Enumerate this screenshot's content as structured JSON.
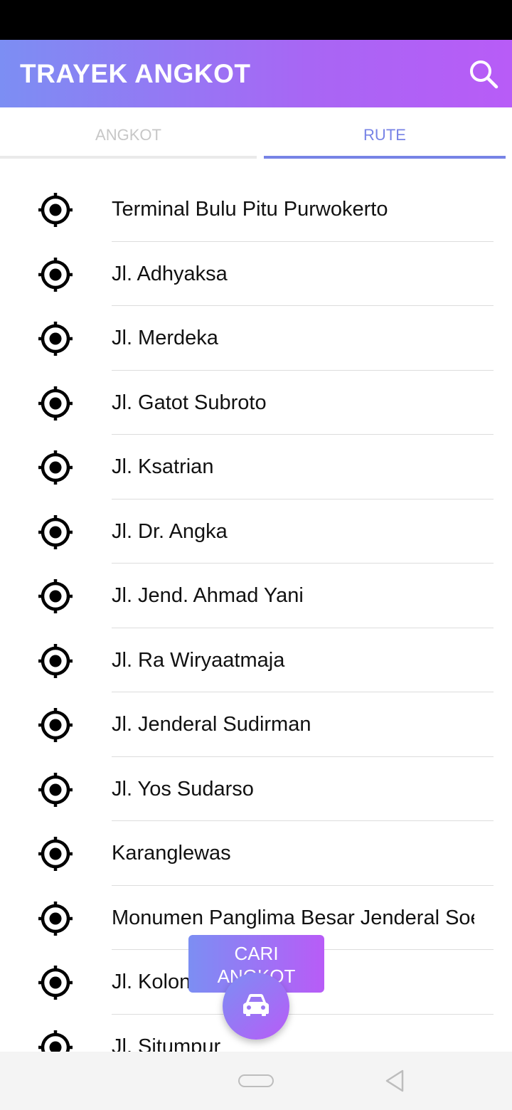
{
  "app_bar": {
    "title": "TRAYEK ANGKOT",
    "search_icon": "search-icon"
  },
  "tabs": [
    {
      "label": "ANGKOT",
      "selected": false
    },
    {
      "label": "RUTE",
      "selected": true
    }
  ],
  "routes": [
    "Terminal Bulu Pitu Purwokerto",
    "Jl. Adhyaksa",
    "Jl. Merdeka",
    "Jl. Gatot Subroto",
    "Jl. Ksatrian",
    "Jl. Dr. Angka",
    "Jl. Jend. Ahmad Yani",
    "Jl. Ra Wiryaatmaja",
    "Jl. Jenderal Sudirman",
    "Jl. Yos Sudarso",
    "Karanglewas",
    "Monumen Panglima Besar Jenderal Soedirman",
    "Jl. Kolonel Sugiri",
    "Jl. Situmpur"
  ],
  "route_icon": "location-target-icon",
  "fab": {
    "label_line1": "CARI",
    "label_line2": "ANGKOT",
    "icon": "car-icon"
  },
  "colors": {
    "gradient_start": "#7c8ef3",
    "gradient_end": "#b85cf7",
    "tab_active": "#7783e6",
    "tab_inactive": "#c7c7c7"
  }
}
